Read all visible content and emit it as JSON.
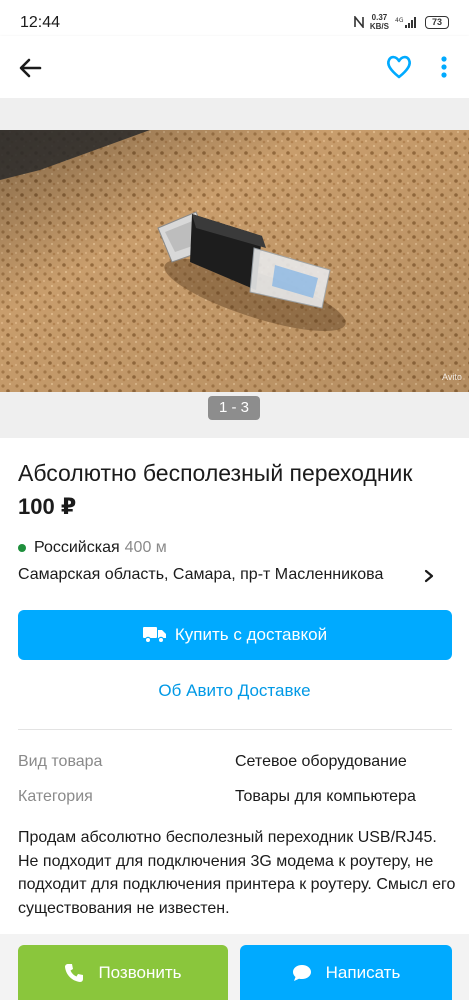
{
  "status_bar": {
    "time": "12:44",
    "net_speed_value": "0.37",
    "net_speed_unit": "KB/S",
    "network": "4G",
    "battery": "73"
  },
  "icons": {
    "back": "arrow-left-icon",
    "favorite": "heart-outline-icon",
    "more": "more-vertical-icon",
    "truck": "truck-icon",
    "phone": "phone-icon",
    "chat": "chat-bubble-icon"
  },
  "gallery": {
    "counter": "1 - 3",
    "watermark": "Avito"
  },
  "listing": {
    "title": "Абсолютно бесполезный переходник",
    "price": "100 ₽",
    "metro_station": "Российская",
    "metro_distance": "400 м",
    "address": "Самарская область, Самара, пр-т Масленникова"
  },
  "actions": {
    "buy_label": "Купить с доставкой",
    "delivery_info_link": "Об Авито Доставке",
    "call_label": "Позвонить",
    "write_label": "Написать"
  },
  "params": [
    {
      "label": "Вид товара",
      "value": "Сетевое оборудование"
    },
    {
      "label": "Категория",
      "value": "Товары для компьютера"
    }
  ],
  "description": "Продам абсолютно бесполезный переходник USB/RJ45. Не подходит для подключения 3G модема к роутеру, не подходит для подключения принтера к роутеру. Смысл его существования не известен.",
  "colors": {
    "accent_blue": "#00aaff",
    "call_green": "#8ac63c",
    "metro_green": "#1e8f3c",
    "link_blue": "#0099e6"
  }
}
